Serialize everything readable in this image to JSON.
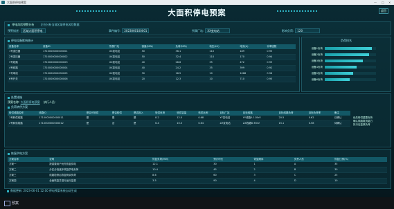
{
  "window": {
    "title": "大面积停电预案"
  },
  "header": {
    "title": "大面积停电预案",
    "date_badge": "返回"
  },
  "topbar": {
    "label": "停电风险预警分析",
    "notice": "正在分析当前区域停电风险数据",
    "fields": [
      {
        "label": "预警描述:",
        "value": "区域大面积停电"
      },
      {
        "label": "事件编号:",
        "value": "2023060100001"
      },
      {
        "label": "所属厂站:",
        "value": "XX变电站"
      },
      {
        "label": "影响负荷:",
        "value": "120"
      }
    ]
  },
  "table1": {
    "title": "停电设备影响统计",
    "headers": [
      "设备名称",
      "设备ID",
      "所属厂站",
      "容量(MW)",
      "负荷(MW)",
      "电压(kV)",
      "电流(A)",
      "功率因数"
    ],
    "rows": [
      [
        "1号变压器",
        "1710000000000001",
        "XX变电站",
        "50",
        "36.1",
        "110",
        "189",
        "0.95"
      ],
      [
        "2号变压器",
        "1710000000000002",
        "XX变电站",
        "50",
        "32.4",
        "110",
        "170",
        "0.94"
      ],
      [
        "3号线路",
        "1710000000000003",
        "XX变电站",
        "40",
        "28.6",
        "35",
        "472",
        "0.93"
      ],
      [
        "4号线路",
        "1710000000000004",
        "XX变电站",
        "40",
        "24.2",
        "35",
        "399",
        "0.92"
      ],
      [
        "5号母线",
        "1710000000000005",
        "XX变电站",
        "30",
        "18.5",
        "10",
        "1068",
        "0.96"
      ],
      [
        "6号开关",
        "1710000000000006",
        "XX变电站",
        "20",
        "12.3",
        "10",
        "710",
        "0.95"
      ]
    ]
  },
  "barchart": {
    "title": "负荷排名",
    "items": [
      {
        "label": "设备1负荷",
        "value": 0.92
      },
      {
        "label": "设备2负荷",
        "value": 0.86
      },
      {
        "label": "设备3负荷",
        "value": 0.74
      },
      {
        "label": "设备4负荷",
        "value": 0.62
      },
      {
        "label": "设备5负荷",
        "value": 0.55
      },
      {
        "label": "设备6负荷",
        "value": 0.48
      }
    ]
  },
  "section2": {
    "title": "处置措施",
    "sub_label": "预案名称:",
    "sub_value": "大面积停电预案",
    "sub_label2": "执行人员:",
    "table_title": "负荷转供方案",
    "headers": [
      "转供线路名称",
      "线路ID",
      "是否可转供",
      "是否转供",
      "是否投入",
      "转供负荷",
      "转供容量",
      "转供比例",
      "目标厂站",
      "目标线路",
      "目标线路负荷",
      "目标负荷率",
      "备注"
    ],
    "rows": [
      [
        "1号转供线路",
        "1710000000000011",
        "是",
        "是",
        "是",
        "8.2",
        "12.0",
        "0.68",
        "YY变电站",
        "YY线路A 110kV",
        "20.5",
        "0.62",
        "已确认"
      ],
      [
        "2号转供线路",
        "1710000000000012",
        "是",
        "否",
        "是",
        "6.4",
        "10.0",
        "0.64",
        "ZZ变电站",
        "ZZ线路B 35kV",
        "15.1",
        "0.58",
        "待确认"
      ]
    ],
    "note_lines": [
      "优先转供重要负荷",
      "确认线路载流能力",
      "执行后复核负荷"
    ]
  },
  "table3": {
    "title": "恢复供电方案",
    "headers": [
      "方案名称",
      "说明",
      "恢复负荷(MW)",
      "预计时长",
      "恢复顺序",
      "负责人员",
      "恢复比例(%)"
    ],
    "rows": [
      [
        "方案一",
        "按重要用户优先恢复供电",
        "12.1",
        "30",
        "1",
        "A",
        "35"
      ],
      [
        "方案二",
        "分区分批逐步恢复供电负荷",
        "10.4",
        "45",
        "2",
        "B",
        "30"
      ],
      [
        "方案三",
        "线路检修后恢复剩余负荷",
        "8.6",
        "60",
        "3",
        "C",
        "25"
      ],
      [
        "方案四",
        "全面恢复并进行运行监视",
        "3.5",
        "90",
        "4",
        "D",
        "10"
      ]
    ]
  },
  "footer": {
    "text": "数据更新: 2023-06-01 12:00 停电预案系统自动生成"
  },
  "taskbar": {
    "label": "预案"
  }
}
